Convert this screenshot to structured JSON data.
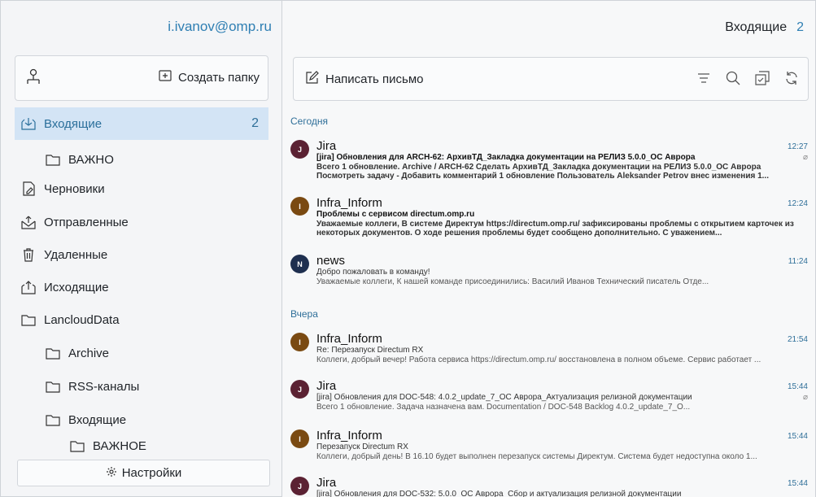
{
  "sidebar": {
    "account": "i.ivanov@omp.ru",
    "toolbar": {
      "create_folder_label": "Создать папку",
      "account_icon": "account-switch-icon",
      "create_icon": "plus-square-icon"
    },
    "folders": [
      {
        "label": "Входящие",
        "count": "2",
        "icon": "inbox-icon",
        "selected": true
      },
      {
        "label": "ВАЖНО",
        "icon": "folder-icon"
      },
      {
        "label": "Черновики",
        "icon": "draft-icon"
      },
      {
        "label": "Отправленные",
        "icon": "sent-icon"
      },
      {
        "label": "Удаленные",
        "icon": "trash-icon"
      },
      {
        "label": "Исходящие",
        "icon": "outbox-icon"
      },
      {
        "label": "LancloudData",
        "icon": "folder-icon"
      },
      {
        "label": "Archive",
        "icon": "folder-icon"
      },
      {
        "label": "RSS-каналы",
        "icon": "folder-icon"
      },
      {
        "label": "Входящие",
        "icon": "folder-icon"
      },
      {
        "label": "ВАЖНОЕ",
        "icon": "folder-icon"
      }
    ],
    "settings_label": "Настройки"
  },
  "main": {
    "header": {
      "title": "Входящие",
      "count": "2"
    },
    "toolbar": {
      "compose_label": "Написать письмо",
      "icons": [
        "filter-icon",
        "search-icon",
        "select-icon",
        "refresh-icon"
      ]
    },
    "sections": [
      {
        "label": "Сегодня",
        "messages": [
          {
            "avatar": "J",
            "sender": "Jira",
            "time": "12:27",
            "subject": "[jira] Обновления для ARCH-62: АрхивТД_Закладка документации на РЕЛИЗ 5.0.0_ОС Аврора",
            "preview": "Всего 1 обновление. Archive / ARCH-62 Сделать АрхивТД_Закладка документации на РЕЛИЗ 5.0.0_ОС Аврора Посмотреть задачу - Добавить комментарий 1 обновление Пользователь Aleksander Petrov внес изменения 1...",
            "unread": true,
            "attachment": true
          },
          {
            "avatar": "I",
            "sender": "Infra_Inform",
            "time": "12:24",
            "subject": "Проблемы с сервисом directum.omp.ru",
            "preview": "Уважаемые коллеги, В системе Директум https://directum.omp.ru/ зафиксированы проблемы с открытием карточек из некоторых документов. О ходе решения проблемы будет сообщено дополнительно. С уважением...",
            "unread": true
          },
          {
            "avatar": "N",
            "sender": "news",
            "time": "11:24",
            "subject": "Добро пожаловать в команду!",
            "preview": "Уважаемые коллеги, К нашей команде присоединились:   Василий Иванов   Технический писатель Отде..."
          }
        ]
      },
      {
        "label": "Вчера",
        "messages": [
          {
            "avatar": "I",
            "sender": "Infra_Inform",
            "time": "21:54",
            "subject": "Re: Перезапуск Directum RX",
            "preview": "Коллеги, добрый вечер! Работа сервиса https://directum.omp.ru/ восстановлена в полном объеме. Сервис работает ..."
          },
          {
            "avatar": "J",
            "sender": "Jira",
            "time": "15:44",
            "subject": "[jira] Обновления для DOC-548: 4.0.2_update_7_ОС Аврора_Актуализация релизной документации",
            "preview": "Всего 1 обновление. Задача назначена вам. Documentation / DOC-548 Backlog 4.0.2_update_7_О...",
            "attachment": true
          },
          {
            "avatar": "I",
            "sender": "Infra_Inform",
            "time": "15:44",
            "subject": "Перезапуск Directum RX",
            "preview": "Коллеги, добрый день! В 16.10 будет выполнен перезапуск системы Директум. Система будет недоступна около 1..."
          },
          {
            "avatar": "J",
            "sender": "Jira",
            "time": "15:44",
            "subject": "[jira] Обновления для DOC-532: 5.0.0_ОС Аврора_Сбор и актуализация релизной документации",
            "preview": ""
          }
        ]
      }
    ]
  }
}
